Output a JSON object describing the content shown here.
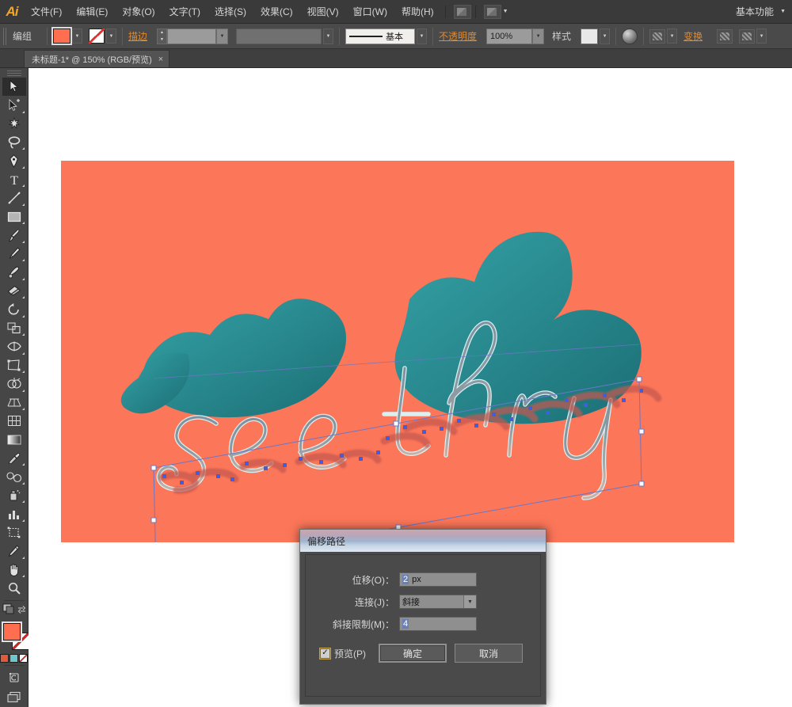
{
  "app": {
    "logo_text": "Ai",
    "workspace_label": "基本功能"
  },
  "menubar": {
    "items": [
      {
        "label": "文件(F)"
      },
      {
        "label": "编辑(E)"
      },
      {
        "label": "对象(O)"
      },
      {
        "label": "文字(T)"
      },
      {
        "label": "选择(S)"
      },
      {
        "label": "效果(C)"
      },
      {
        "label": "视图(V)"
      },
      {
        "label": "窗口(W)"
      },
      {
        "label": "帮助(H)"
      }
    ]
  },
  "controlbar": {
    "selection_label": "编组",
    "fill_color": "#ff6f4f",
    "stroke_color": "#ffffff",
    "stroke_label": "描边",
    "stroke_weight": "",
    "stroke_profile": "基本",
    "opacity_label": "不透明度",
    "opacity_value": "100%",
    "style_label": "样式",
    "transform_label": "变换",
    "align_icon": "align-icon",
    "recolor_icon": "recolor-artwork-icon",
    "isolate_icon": "isolate-icon",
    "more_icon": "more-options-icon"
  },
  "tabbar": {
    "tab_title": "未标题-1* @ 150% (RGB/预览)",
    "close_label": "×"
  },
  "toolbar": {
    "tools": [
      {
        "name": "selection-tool",
        "active": true
      },
      {
        "name": "direct-selection-tool",
        "active": false
      },
      {
        "name": "magic-wand-tool",
        "active": false
      },
      {
        "name": "lasso-tool",
        "active": false
      },
      {
        "name": "pen-tool",
        "active": false
      },
      {
        "name": "type-tool",
        "active": false
      },
      {
        "name": "line-segment-tool",
        "active": false
      },
      {
        "name": "rectangle-tool",
        "active": false
      },
      {
        "name": "paintbrush-tool",
        "active": false
      },
      {
        "name": "pencil-tool",
        "active": false
      },
      {
        "name": "blob-brush-tool",
        "active": false
      },
      {
        "name": "eraser-tool",
        "active": false
      },
      {
        "name": "rotate-tool",
        "active": false
      },
      {
        "name": "scale-tool",
        "active": false
      },
      {
        "name": "width-tool",
        "active": false
      },
      {
        "name": "free-transform-tool",
        "active": false
      },
      {
        "name": "shape-builder-tool",
        "active": false
      },
      {
        "name": "perspective-grid-tool",
        "active": false
      },
      {
        "name": "mesh-tool",
        "active": false
      },
      {
        "name": "gradient-tool",
        "active": false
      },
      {
        "name": "eyedropper-tool",
        "active": false
      },
      {
        "name": "blend-tool",
        "active": false
      },
      {
        "name": "symbol-sprayer-tool",
        "active": false
      },
      {
        "name": "column-graph-tool",
        "active": false
      },
      {
        "name": "artboard-tool",
        "active": false
      },
      {
        "name": "slice-tool",
        "active": false
      },
      {
        "name": "hand-tool",
        "active": false
      },
      {
        "name": "zoom-tool",
        "active": false
      }
    ],
    "fill_swatch": "#ff6f4f",
    "stroke_swatch": "#ffffff",
    "mini_swatches": [
      "#e05a3c",
      "#6fc7cc",
      "#e05a3c"
    ],
    "draw_mode_icon": "draw-normal-icon",
    "screen_mode_icon": "screen-mode-icon"
  },
  "artwork": {
    "background_color": "#fc7659",
    "text_line": "see thru",
    "text_fill_top": "#3fb4bd",
    "text_fill_shadow": "#1c8e93",
    "text_outline": "#d9f4f7",
    "reflection_color": "#c4584f",
    "anchor_color": "#3f5fe0",
    "selection_stroke": "#6878c8"
  },
  "dialog": {
    "title": "偏移路径",
    "rows": [
      {
        "label": "位移(O)：",
        "value": "2",
        "unit": "px",
        "type": "input"
      },
      {
        "label": "连接(J)：",
        "value": "斜接",
        "type": "select"
      },
      {
        "label": "斜接限制(M)：",
        "value": "4",
        "type": "input"
      }
    ],
    "preview_label": "预览(P)",
    "preview_checked": true,
    "check_glyph": "✓",
    "ok_label": "确定",
    "cancel_label": "取消"
  }
}
